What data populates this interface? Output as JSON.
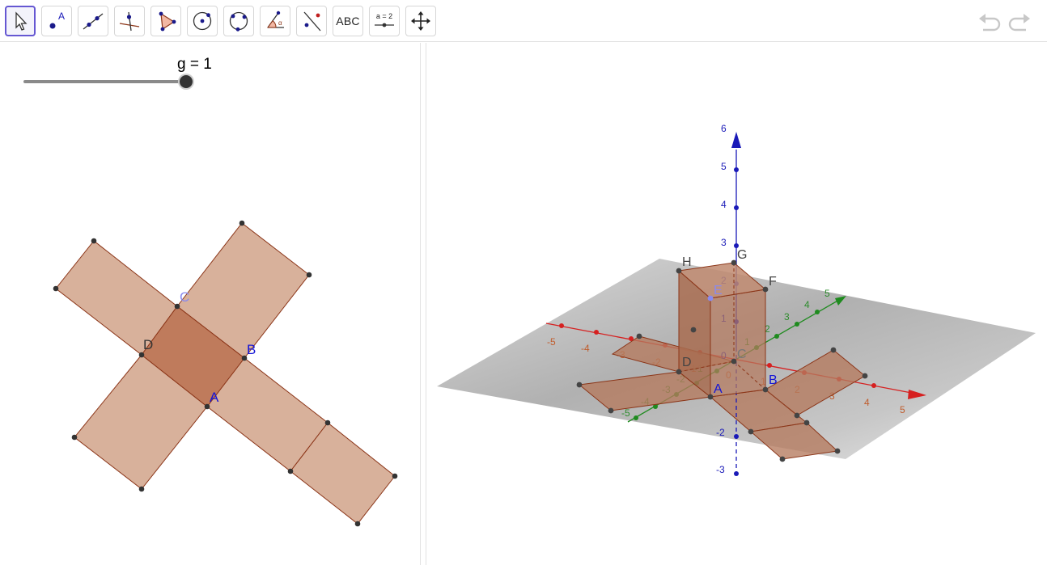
{
  "toolbar": {
    "tools": [
      {
        "name": "move-tool",
        "icon": "arrow-pointer-icon"
      },
      {
        "name": "point-tool",
        "icon": "point-icon",
        "label": "A"
      },
      {
        "name": "line-tool",
        "icon": "line-through-points-icon"
      },
      {
        "name": "perpendicular-line-tool",
        "icon": "perpendicular-icon"
      },
      {
        "name": "polygon-tool",
        "icon": "polygon-icon"
      },
      {
        "name": "circle-center-point-tool",
        "icon": "circle-center-icon"
      },
      {
        "name": "circle-three-points-tool",
        "icon": "circle-three-points-icon"
      },
      {
        "name": "angle-tool",
        "icon": "angle-icon"
      },
      {
        "name": "reflect-about-line-tool",
        "icon": "reflect-line-icon"
      },
      {
        "name": "text-tool",
        "icon": "text-icon",
        "label": "ABC"
      },
      {
        "name": "slider-tool",
        "icon": "slider-icon",
        "label": "a = 2"
      },
      {
        "name": "move-graphics-view-tool",
        "icon": "move-arrows-icon"
      }
    ],
    "undo_icon": "undo-icon",
    "redo_icon": "redo-icon"
  },
  "slider": {
    "label": "g = 1",
    "value": 1,
    "min": 0,
    "max": 1
  },
  "view2d": {
    "point_labels": {
      "A": "A",
      "B": "B",
      "C": "C",
      "D": "D"
    },
    "colors": {
      "face": "#d4a890",
      "base": "#c07a5a",
      "edge": "#8b3518",
      "point": "#333333",
      "blue_label": "#1515d6",
      "dark_label": "#333333",
      "faint_label": "#8a8aee"
    }
  },
  "view3d": {
    "z_ticks": [
      "6",
      "5",
      "4",
      "3",
      "2",
      "1",
      "0",
      "-2",
      "-3"
    ],
    "x_ticks": [
      "-5",
      "-4",
      "-3",
      "-2",
      "-1",
      "0",
      "1",
      "2",
      "3",
      "4",
      "5"
    ],
    "y_ticks": [
      "-5",
      "-4",
      "-3",
      "-2",
      "-1",
      "1",
      "2",
      "3",
      "4",
      "5"
    ],
    "point_labels": {
      "A": "A",
      "B": "B",
      "C": "C",
      "D": "D",
      "E": "E",
      "F": "F",
      "G": "G",
      "H": "H"
    },
    "colors": {
      "x_axis": "#d62020",
      "y_axis": "#1f8b1f",
      "z_axis": "#1a1ab8",
      "x_label": "#c05c2c",
      "y_label": "#2d8c2d",
      "z_label": "#1a1ab8",
      "face": "#b57a5e",
      "edge": "#8b3518"
    }
  }
}
